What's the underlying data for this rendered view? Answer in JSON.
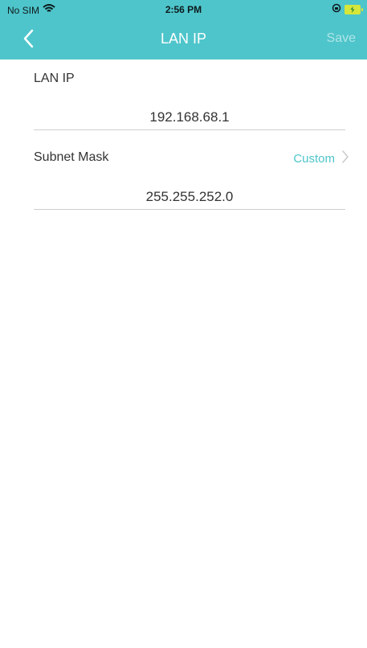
{
  "status_bar": {
    "carrier": "No SIM",
    "time": "2:56 PM",
    "wifi_icon": "wifi-icon",
    "lock_icon": "orientation-lock-icon",
    "battery_icon": "battery-charging-icon"
  },
  "nav": {
    "back_icon": "chevron-left-icon",
    "title": "LAN IP",
    "save_label": "Save"
  },
  "form": {
    "lan_ip": {
      "label": "LAN IP",
      "value": "192.168.68.1"
    },
    "subnet_mask": {
      "label": "Subnet Mask",
      "mode": "Custom",
      "chevron_icon": "chevron-right-icon",
      "value": "255.255.252.0"
    }
  },
  "colors": {
    "header": "#4ec5cb",
    "accent": "#4ec5cb",
    "text": "#333333",
    "divider": "#cfcfcf"
  }
}
